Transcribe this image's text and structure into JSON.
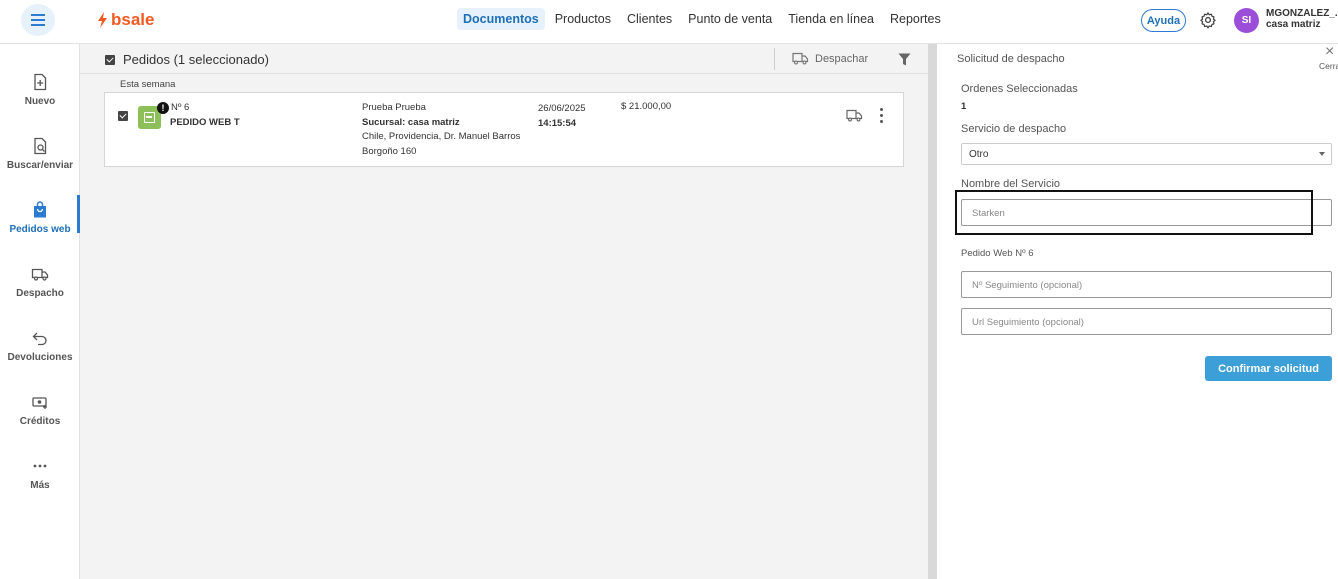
{
  "header": {
    "brand": "bsale",
    "nav": [
      "Documentos",
      "Productos",
      "Clientes",
      "Punto de venta",
      "Tienda en línea",
      "Reportes"
    ],
    "active_nav": "Documentos",
    "help_label": "Ayuda",
    "avatar_initials": "SI",
    "user_name": "MGONZALEZ_...",
    "user_branch": "casa matriz"
  },
  "sidebar": {
    "items": [
      {
        "label": "Nuevo",
        "icon": "file-plus-icon"
      },
      {
        "label": "Buscar/enviar",
        "icon": "file-search-icon"
      },
      {
        "label": "Pedidos web",
        "icon": "shopping-bag-icon"
      },
      {
        "label": "Despacho",
        "icon": "truck-icon"
      },
      {
        "label": "Devoluciones",
        "icon": "return-arrow-icon"
      },
      {
        "label": "Créditos",
        "icon": "money-icon"
      },
      {
        "label": "Más",
        "icon": "more-dots-icon"
      }
    ],
    "active": "Pedidos web"
  },
  "orders": {
    "title": "Pedidos (1 seleccionado)",
    "dispatch_label": "Despachar",
    "group_label": "Esta semana",
    "card": {
      "number": "Nº 6",
      "name": "PEDIDO WEB T",
      "customer": "Prueba Prueba",
      "branch": "Sucursal: casa matriz",
      "address_line1": "Chile, Providencia, Dr. Manuel Barros",
      "address_line2": "Borgoño 160",
      "date": "26/06/2025",
      "time": "14:15:54",
      "amount": "$ 21.000,00",
      "status_color": "#8dbf5a"
    }
  },
  "panel": {
    "title": "Solicitud de despacho",
    "close_label": "Cerrar",
    "orders_label": "Ordenes Seleccionadas",
    "orders_count": "1",
    "service_label": "Servicio de despacho",
    "service_value": "Otro",
    "service_name_label": "Nombre del Servicio",
    "service_name_value": "Starken",
    "order_label": "Pedido Web Nº 6",
    "tracking_placeholder": "Nº Seguimiento (opcional)",
    "url_placeholder": "Url Seguimiento (opcional)",
    "confirm_label": "Confirmar solicitud"
  },
  "colors": {
    "accent": "#2b7bd0",
    "brand": "#f15a22",
    "confirm": "#3d9fd8"
  }
}
